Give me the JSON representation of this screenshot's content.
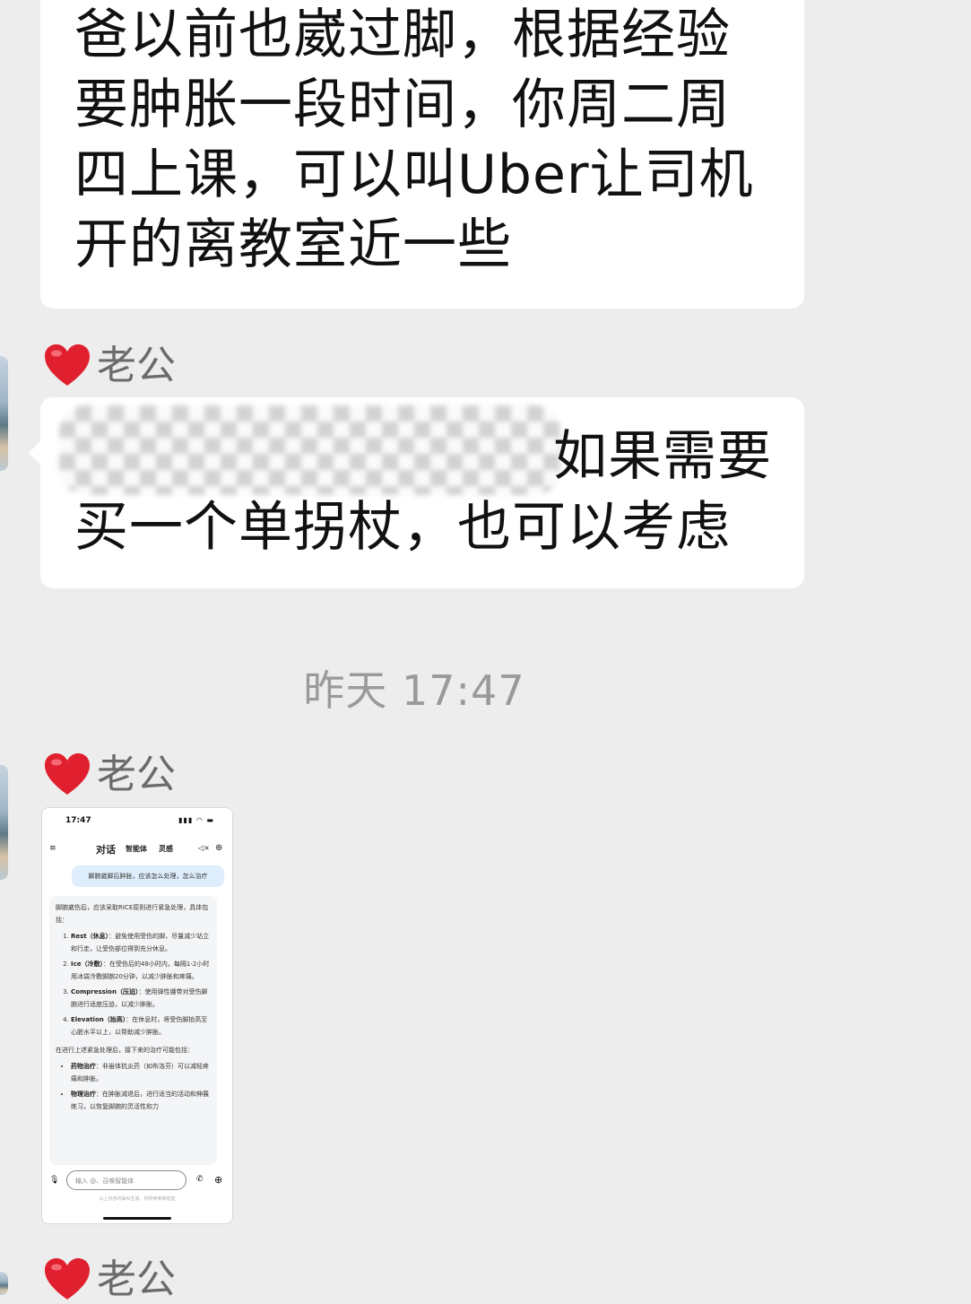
{
  "messages": {
    "first": {
      "text": "爸以前也崴过脚，根据经验\n要肿胀一段时间，你周二周\n四上课，可以叫Uber让司机\n开的离教室近一些"
    },
    "second": {
      "sender": "老公",
      "text_line1": "如果需要",
      "text_line2": "买一个单拐杖，也可以考虑"
    },
    "timestamp": "昨天 17:47",
    "third": {
      "sender": "老公"
    },
    "fourth": {
      "sender": "老公"
    }
  },
  "thumbnail": {
    "time": "17:47",
    "status_icons": "▮▮▮ ◠ ▬",
    "nav": {
      "menu_icon": "≡",
      "tab_active": "对话",
      "tab2": "智能体",
      "tab3": "灵感",
      "mute_icon": "◁×",
      "plus_icon": "⊕"
    },
    "user_message": "脚腕崴脚后肿胀，应该怎么处理，怎么治疗",
    "answer_intro": "脚腕崴伤后，应该采取RICE原则进行紧急处理，具体包括：",
    "rice_items": [
      {
        "title": "Rest（休息）",
        "body": "：避免使用受伤的脚，尽量减少站立和行走，让受伤部位得到充分休息。"
      },
      {
        "title": "Ice（冷敷）",
        "body": "：在受伤后的48小时内，每隔1-2小时用冰袋冷敷脚腕20分钟，以减少肿胀和疼痛。"
      },
      {
        "title": "Compression（压迫）",
        "body": "：使用弹性绷带对受伤脚腕进行适度压迫，以减少肿胀。"
      },
      {
        "title": "Elevation（抬高）",
        "body": "：在休息时，将受伤脚抬高至心脏水平以上，以帮助减少肿胀。"
      }
    ],
    "answer_followup": "在进行上述紧急处理后，接下来的治疗可能包括：",
    "treatment_items": [
      {
        "title": "药物治疗",
        "body": "：非甾体抗炎药（如布洛芬）可以减轻疼痛和肿胀。"
      },
      {
        "title": "物理治疗",
        "body": "：在肿胀减退后，进行适当的活动和伸展练习，以恢复脚腕的灵活性和力"
      }
    ],
    "input_placeholder": "输入 @、召唤智能体",
    "mic_icon": "🎙",
    "phone_icon": "✆",
    "add_icon": "⊕",
    "disclaimer": "以上内容均由AI生成，仅供参考和借鉴"
  }
}
